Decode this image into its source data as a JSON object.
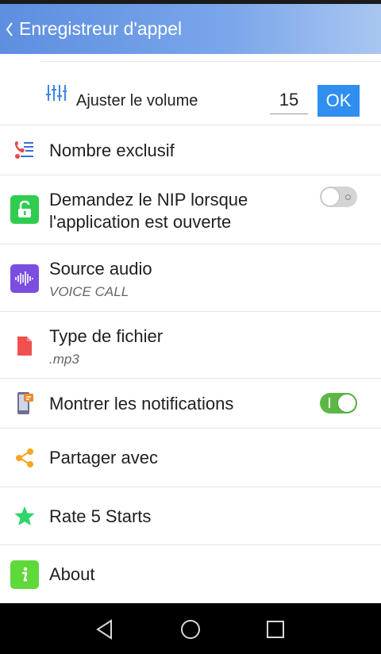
{
  "appbar": {
    "title": "Enregistreur d'appel",
    "back_icon": "chevron-left-icon"
  },
  "volume": {
    "label": "Ajuster le volume",
    "value": "15",
    "ok_label": "OK",
    "icon": "equalizer-icon"
  },
  "settings": [
    {
      "id": "exclusive",
      "title": "Nombre exclusif",
      "icon": "contact-list-icon",
      "icon_color": "#3a6fd8"
    },
    {
      "id": "pin",
      "title_line1": "Demandez le NIP lorsque",
      "title_line2": "l'application est ouverte",
      "icon": "lock-icon",
      "icon_color": "#2fcc4f",
      "toggle": "off"
    },
    {
      "id": "audio_source",
      "title": "Source audio",
      "subtitle": "VOICE CALL",
      "icon": "audio-wave-icon",
      "icon_color": "#7b4de0"
    },
    {
      "id": "file_type",
      "title": "Type de fichier",
      "subtitle": ".mp3",
      "icon": "file-icon",
      "icon_color": "#f05050"
    },
    {
      "id": "notifications",
      "title": "Montrer les notifications",
      "icon": "phone-notification-icon",
      "icon_color": "#f08a30",
      "toggle": "on"
    },
    {
      "id": "share",
      "title": "Partager avec",
      "icon": "share-icon",
      "icon_color": "#f5a623"
    },
    {
      "id": "rate",
      "title": "Rate 5 Starts",
      "icon": "star-icon",
      "icon_color": "#2fd46a"
    },
    {
      "id": "about",
      "title": "About",
      "icon": "info-icon",
      "icon_color": "#5fd83a"
    }
  ],
  "navbar": {
    "back": "nav-back-icon",
    "home": "nav-home-icon",
    "recents": "nav-recents-icon"
  }
}
